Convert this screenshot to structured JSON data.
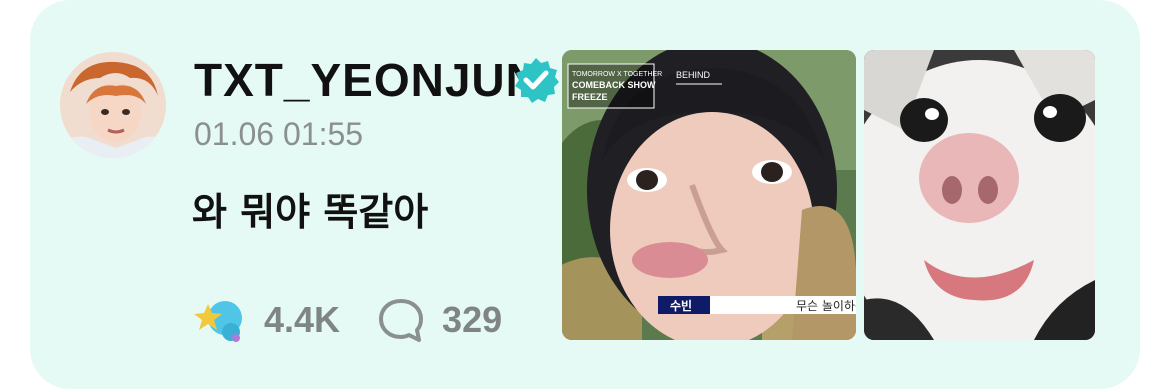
{
  "post": {
    "username": "TXT_YEONJUN",
    "timestamp": "01.06 01:55",
    "text": "와 뭐야 똑같아",
    "likes": "4.4K",
    "comments": "329"
  },
  "media": [
    {
      "type": "video-screenshot",
      "overlay_title_line1": "TOMORROW X TOGETHER",
      "overlay_title_line2": "COMEBACK SHOW",
      "overlay_title_line3": "FREEZE",
      "overlay_behind": "BEHIND",
      "caption_name": "수빈",
      "caption_text": "무슨 놀이하는"
    },
    {
      "type": "photo-cat"
    }
  ],
  "colors": {
    "card_bg": "#e6faf5",
    "verified": "#2ec4c6",
    "muted_text": "#8a8f8f",
    "accent_caption": "#0f1b66"
  },
  "icons": {
    "verified": "verified-badge-icon",
    "like": "star-reaction-icon",
    "comment": "comment-bubble-icon"
  }
}
